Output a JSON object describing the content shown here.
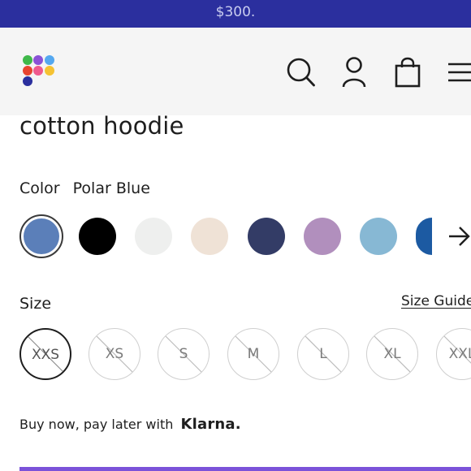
{
  "banner": {
    "text": "$300."
  },
  "header": {
    "logo": "multicolor-dots-logo",
    "icons": [
      "search-icon",
      "account-icon",
      "shopping-bag-icon",
      "menu-icon"
    ]
  },
  "product": {
    "title": "cotton hoodie"
  },
  "color": {
    "label": "Color",
    "selected": "Polar Blue",
    "swatches": [
      "#5b7fb9",
      "#000000",
      "#eeefee",
      "#efe2d6",
      "#333c66",
      "#b18fbd",
      "#87b8d4",
      "#1c5aa2"
    ],
    "next_icon": "arrow-right-icon"
  },
  "size": {
    "label": "Size",
    "guide_label": "Size Guide",
    "options": [
      "XXS",
      "XS",
      "S",
      "M",
      "L",
      "XL",
      "XXL"
    ],
    "selected": "XXS",
    "unavailable": true
  },
  "payment": {
    "text": "Buy now, pay later with",
    "brand": "Klarna."
  },
  "colors": {
    "banner": "#2b2f9e",
    "header": "#f5f5f5",
    "accent": "#7b52d9"
  }
}
